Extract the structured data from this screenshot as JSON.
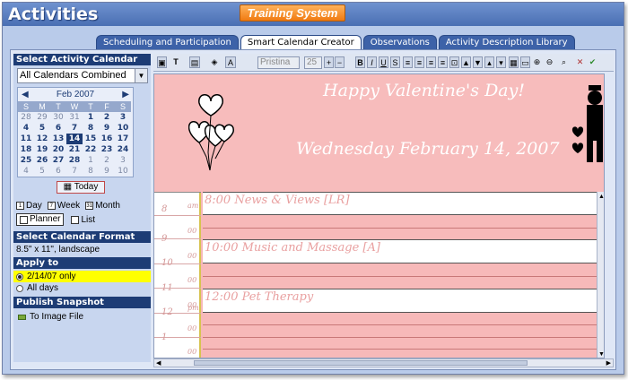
{
  "app": {
    "title": "Activities",
    "brand": "Training System"
  },
  "tabs": [
    {
      "label": "Scheduling and Participation",
      "active": false
    },
    {
      "label": "Smart Calendar Creator",
      "active": true
    },
    {
      "label": "Observations",
      "active": false
    },
    {
      "label": "Activity Description Library",
      "active": false
    }
  ],
  "sidebar": {
    "select_calendar_heading": "Select Activity Calendar",
    "calendar_select_value": "All Calendars Combined",
    "calendar": {
      "month_label": "Feb 2007",
      "prev": "◀",
      "next": "▶",
      "weekdays": [
        "S",
        "M",
        "T",
        "W",
        "T",
        "F",
        "S"
      ],
      "weeks": [
        [
          "28",
          "29",
          "30",
          "31",
          "1",
          "2",
          "3"
        ],
        [
          "4",
          "5",
          "6",
          "7",
          "8",
          "9",
          "10"
        ],
        [
          "11",
          "12",
          "13",
          "14",
          "15",
          "16",
          "17"
        ],
        [
          "18",
          "19",
          "20",
          "21",
          "22",
          "23",
          "24"
        ],
        [
          "25",
          "26",
          "27",
          "28",
          "1",
          "2",
          "3"
        ],
        [
          "4",
          "5",
          "6",
          "7",
          "8",
          "9",
          "10"
        ]
      ],
      "selected_day": "14"
    },
    "today_label": "Today",
    "view_day": "Day",
    "view_week": "Week",
    "view_month": "Month",
    "view_planner": "Planner",
    "view_list": "List",
    "format_heading": "Select Calendar Format",
    "format_value": "8.5\" x 11\", landscape",
    "apply_heading": "Apply to",
    "apply_option_1": "2/14/07 only",
    "apply_option_2": "All days",
    "publish_heading": "Publish Snapshot",
    "publish_option": "To Image File"
  },
  "toolbar": {
    "font_value": "Pristina",
    "size_value": "25"
  },
  "canvas": {
    "greeting": "Happy Valentine's Day!",
    "date_heading": "Wednesday February 14, 2007",
    "hours": [
      "8",
      "9",
      "10",
      "11",
      "12",
      "1"
    ],
    "am_label": "am",
    "pm_label": "pm",
    "minute_label": "00",
    "events": [
      {
        "text": "8:00 News & Views [LR]"
      },
      {
        "text": "10:00 Music and Massage [A]"
      },
      {
        "text": "12:00 Pet Therapy"
      }
    ]
  },
  "colors": {
    "banner": "#f7bcbc",
    "navy": "#1d3c75",
    "highlight": "#ffff00"
  }
}
